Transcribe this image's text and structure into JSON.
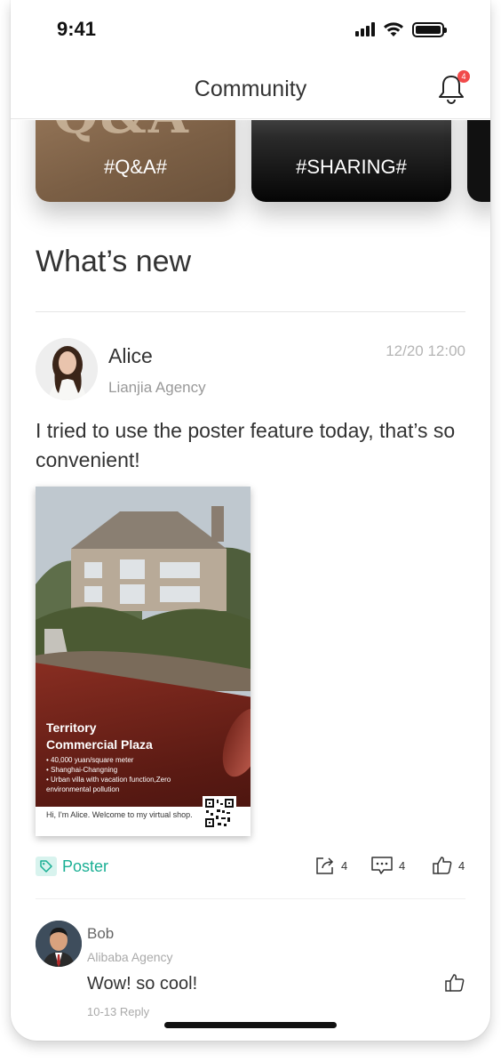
{
  "status_bar": {
    "time": "9:41"
  },
  "nav": {
    "title": "Community",
    "notification_count": "4"
  },
  "topics": [
    {
      "label": "#Q&A#",
      "art_text": "Q&A"
    },
    {
      "label": "#SHARING#"
    }
  ],
  "section": {
    "title": "What’s new"
  },
  "post": {
    "author": "Alice",
    "agency": "Lianjia Agency",
    "time": "12/20 12:00",
    "text": "I tried to use the poster feature today, that’s so convenient!",
    "poster": {
      "title_line1": "Territory",
      "title_line2": "Commercial Plaza",
      "bullets": [
        "40,000 yuan/square meter",
        "Shanghai-Changning",
        "Urban villa with vacation function,Zero environmental pollution"
      ],
      "footer": "Hi, I'm Alice. Welcome to my virtual shop."
    },
    "tag": "Poster",
    "share_count": "4",
    "comment_count": "4",
    "like_count": "4"
  },
  "comment": {
    "author": "Bob",
    "agency": "Alibaba Agency",
    "text": "Wow! so cool!",
    "meta": "10-13  Reply"
  },
  "colors": {
    "accent": "#1aaf94",
    "badge": "#f14a4a",
    "text": "#333333",
    "muted": "#999999"
  }
}
